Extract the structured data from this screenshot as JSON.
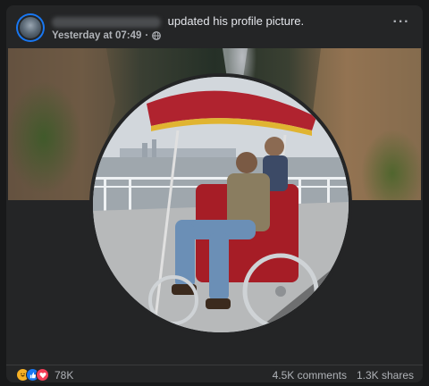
{
  "post": {
    "author_name": "Nhật Bảo Tuấn Tuấn",
    "action_text": "updated his profile picture.",
    "timestamp": "Yesterday at 07:49",
    "separator": "·",
    "audience_icon": "globe-icon",
    "more_label": "···"
  },
  "reactions": {
    "icons": [
      "haha-icon",
      "like-icon",
      "love-icon"
    ],
    "count": "78K"
  },
  "stats": {
    "comments": "4.5K comments",
    "shares": "1.3K shares"
  },
  "colors": {
    "card_bg": "#242526",
    "page_bg": "#18191a",
    "text_primary": "#e4e6eb",
    "text_secondary": "#b0b3b8",
    "like_blue": "#1877f2",
    "love_red": "#f33e58",
    "haha_yellow": "#f7b125"
  }
}
